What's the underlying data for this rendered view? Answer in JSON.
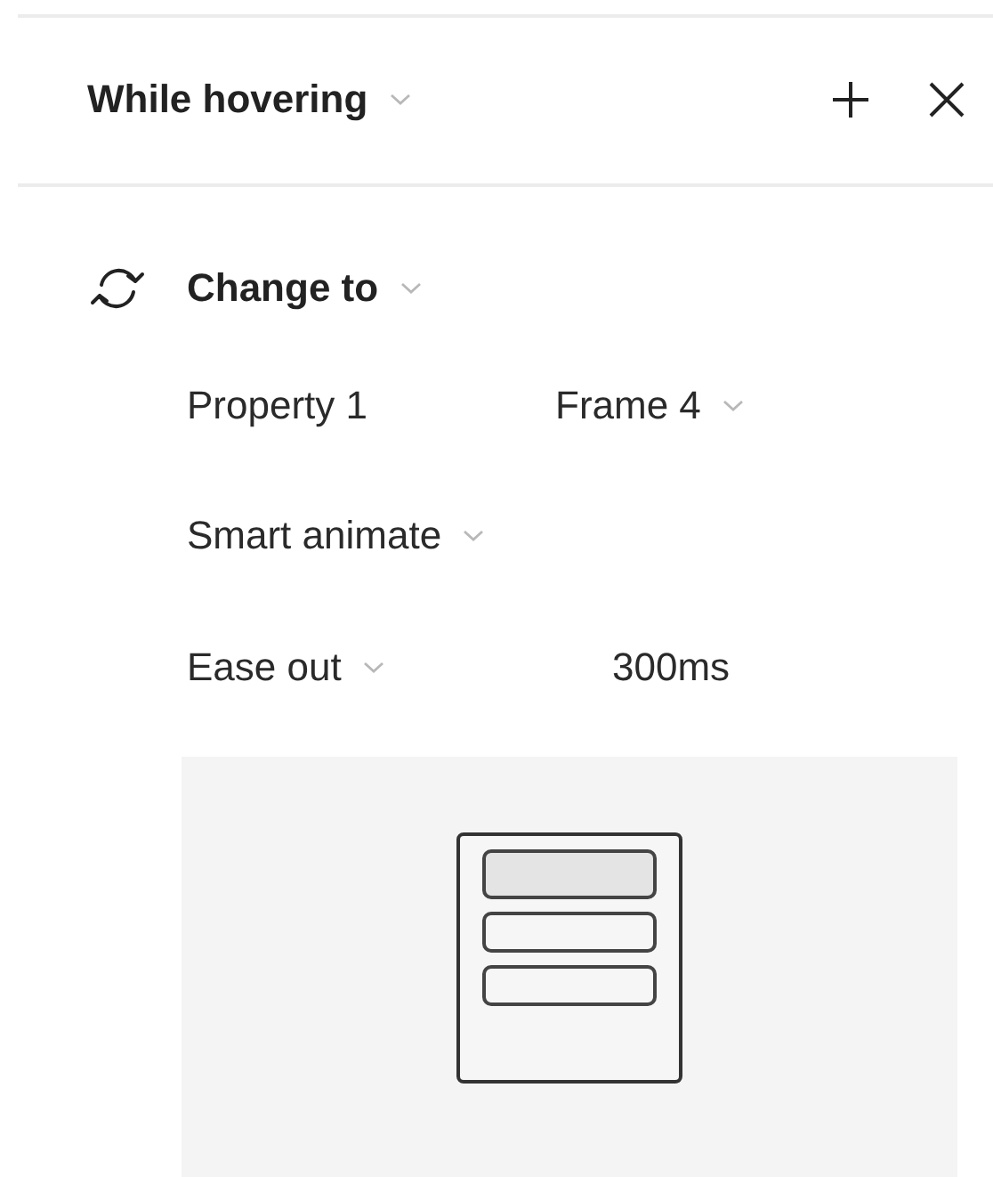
{
  "header": {
    "title": "While hovering"
  },
  "action": {
    "label": "Change to"
  },
  "rows": [
    {
      "kind": "pair",
      "label": "Property 1",
      "value": "Frame 4"
    },
    {
      "kind": "select",
      "value": "Smart animate"
    },
    {
      "kind": "timing",
      "value": "Ease out",
      "duration": "300ms"
    }
  ]
}
